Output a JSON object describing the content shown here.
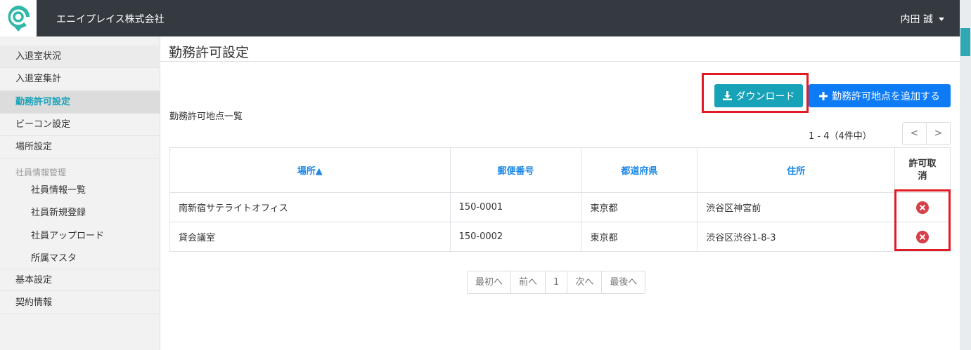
{
  "header": {
    "company": "エニイプレイス株式会社",
    "user": "内田 誠"
  },
  "sidebar": {
    "items": [
      {
        "label": "入退室状況"
      },
      {
        "label": "入退室集計"
      },
      {
        "label": "勤務許可設定"
      },
      {
        "label": "ビーコン設定"
      },
      {
        "label": "場所設定"
      }
    ],
    "group_label": "社員情報管理",
    "sub_items": [
      {
        "label": "社員情報一覧"
      },
      {
        "label": "社員新規登録"
      },
      {
        "label": "社員アップロード"
      },
      {
        "label": "所属マスタ"
      }
    ],
    "bottom_items": [
      {
        "label": "基本設定"
      },
      {
        "label": "契約情報"
      }
    ]
  },
  "main": {
    "title": "勤務許可設定",
    "download_label": "ダウンロード",
    "add_label": "勤務許可地点を追加する",
    "list_title": "勤務許可地点一覧",
    "count": "1 - 4（4件中）",
    "prev_symbol": "<",
    "next_symbol": ">",
    "table": {
      "headers": [
        "場所▲",
        "郵便番号",
        "都道府県",
        "住所",
        "許可取消"
      ],
      "rows": [
        {
          "place": "南新宿サテライトオフィス",
          "zip": "150-0001",
          "pref": "東京都",
          "address": "渋谷区神宮前"
        },
        {
          "place": "貸会議室",
          "zip": "150-0002",
          "pref": "東京都",
          "address": "渋谷区渋谷1-8-3"
        }
      ]
    },
    "pagination": [
      "最初へ",
      "前へ",
      "1",
      "次へ",
      "最後へ"
    ]
  },
  "colors": {
    "accent": "#17a2b8",
    "primary": "#0d7bf5",
    "highlight": "#e01b24",
    "danger": "#d6404a"
  }
}
